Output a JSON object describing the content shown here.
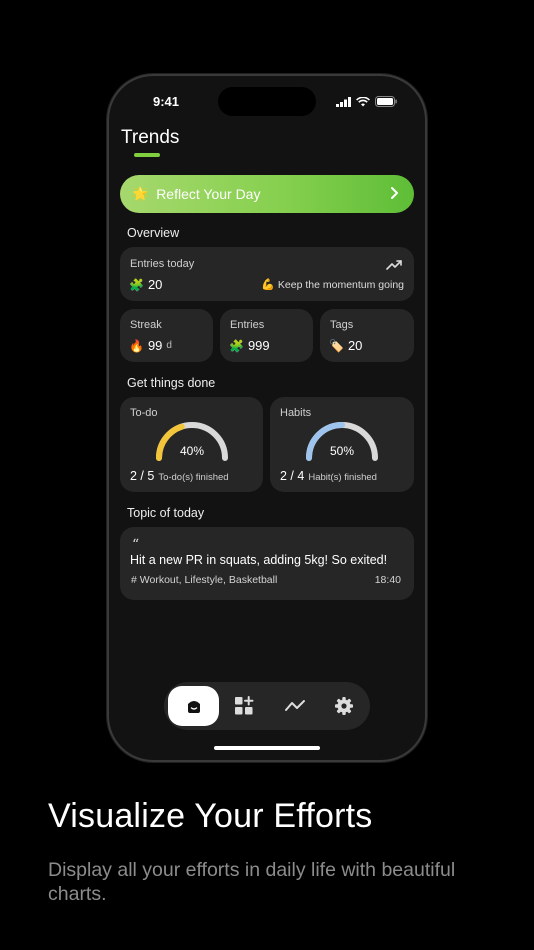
{
  "status_bar": {
    "time": "9:41"
  },
  "header": {
    "title": "Trends"
  },
  "reflect": {
    "label": "Reflect Your Day",
    "icon": "sparkle-star-icon"
  },
  "overview": {
    "title": "Overview",
    "entries_today": {
      "label": "Entries today",
      "value": "20",
      "motivation": "Keep the momentum going"
    },
    "streak": {
      "label": "Streak",
      "value": "99",
      "unit": "d"
    },
    "entries": {
      "label": "Entries",
      "value": "999"
    },
    "tags": {
      "label": "Tags",
      "value": "20"
    }
  },
  "get_things_done": {
    "title": "Get things done",
    "todo": {
      "label": "To-do",
      "percent_text": "40%",
      "percent": 0.4,
      "fraction": "2 / 5",
      "sub": "To-do(s) finished",
      "color": "#f3c53a"
    },
    "habits": {
      "label": "Habits",
      "percent_text": "50%",
      "percent": 0.5,
      "fraction": "2 / 4",
      "sub": "Habit(s) finished",
      "color": "#9ec3ec"
    }
  },
  "topic": {
    "title": "Topic of today",
    "quote_mark": "“",
    "text": "Hit a new PR in squats, adding 5kg! So exited!",
    "tags": "# Workout, Lifestyle, Basketball",
    "time": "18:40"
  },
  "tabbar": {
    "tabs": [
      "home-icon",
      "widgets-icon",
      "trends-icon",
      "settings-icon"
    ],
    "active": 0
  },
  "promo": {
    "headline": "Visualize Your Efforts",
    "subline": "Display all your efforts in daily life with beautiful charts."
  },
  "colors": {
    "accent_green": "#7fcf3f",
    "card_bg": "#262626",
    "gauge_track": "#d9d9d9"
  }
}
